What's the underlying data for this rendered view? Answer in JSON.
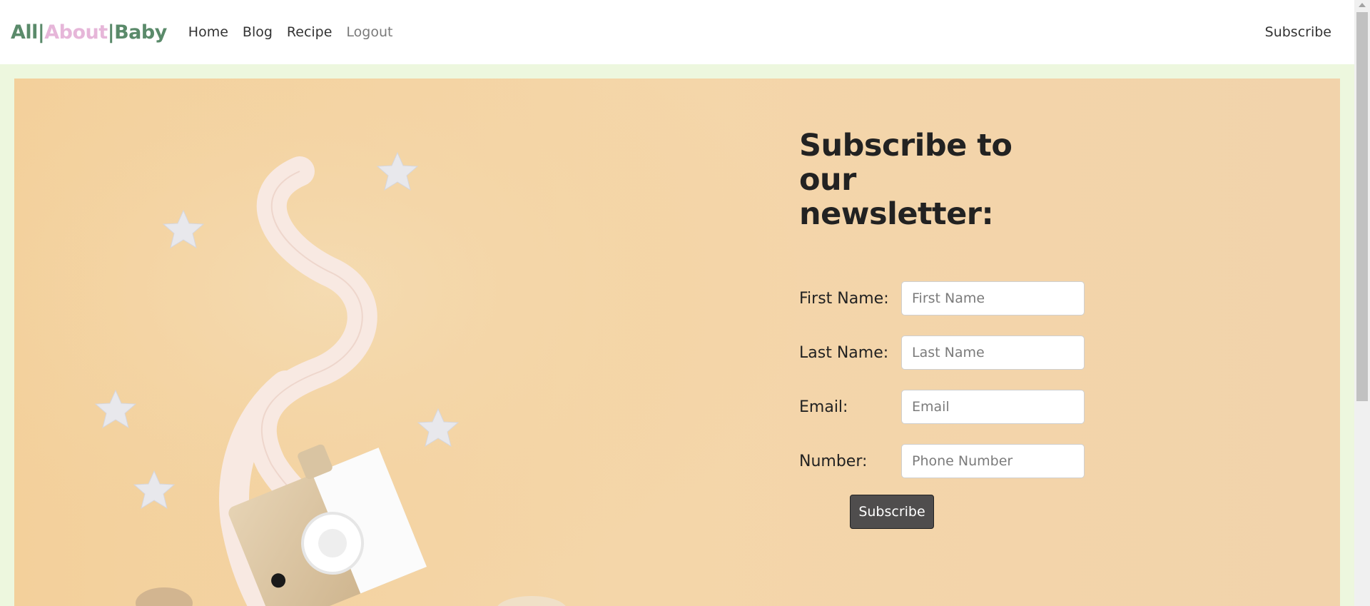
{
  "brand": {
    "part1": "All",
    "sep1": "|",
    "part2": "About",
    "sep2": "|",
    "part3": "Baby"
  },
  "nav": {
    "links": [
      {
        "label": "Home"
      },
      {
        "label": "Blog"
      },
      {
        "label": "Recipe"
      },
      {
        "label": "Logout"
      }
    ],
    "subscribe_label": "Subscribe"
  },
  "newsletter": {
    "title": "Subscribe to our newsletter:",
    "fields": [
      {
        "label": "First Name:",
        "placeholder": "First Name"
      },
      {
        "label": "Last Name:",
        "placeholder": "Last Name"
      },
      {
        "label": "Email:",
        "placeholder": "Email"
      },
      {
        "label": "Number:",
        "placeholder": "Phone Number"
      }
    ],
    "submit_label": "Subscribe"
  },
  "colors": {
    "brand_green": "#5a8a6a",
    "brand_pink": "#e6b6d9",
    "page_background": "#edf7de",
    "hero_background": "#f3d09b",
    "button_background": "#4f4d4d"
  },
  "icons": {
    "hero_image": "baby-toy-camera-with-stars"
  }
}
